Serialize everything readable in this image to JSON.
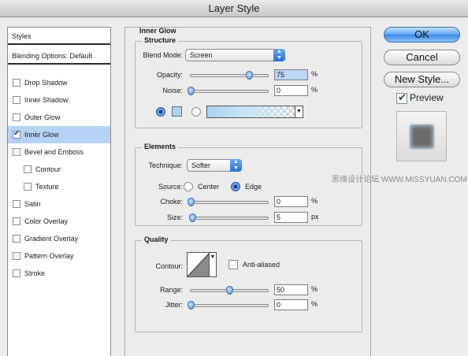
{
  "window": {
    "title": "Layer Style"
  },
  "left_panel": {
    "styles_label": "Styles",
    "blending_label": "Blending Options: Default",
    "items": [
      {
        "label": "Drop Shadow",
        "checked": false,
        "selected": false,
        "sub": false
      },
      {
        "label": "Inner Shadow",
        "checked": false,
        "selected": false,
        "sub": false
      },
      {
        "label": "Outer Glow",
        "checked": false,
        "selected": false,
        "sub": false
      },
      {
        "label": "Inner Glow",
        "checked": true,
        "selected": true,
        "sub": false
      },
      {
        "label": "Bevel and Emboss",
        "checked": false,
        "selected": false,
        "sub": false
      },
      {
        "label": "Contour",
        "checked": false,
        "selected": false,
        "sub": true
      },
      {
        "label": "Texture",
        "checked": false,
        "selected": false,
        "sub": true
      },
      {
        "label": "Satin",
        "checked": false,
        "selected": false,
        "sub": false
      },
      {
        "label": "Color Overlay",
        "checked": false,
        "selected": false,
        "sub": false
      },
      {
        "label": "Gradient Overlay",
        "checked": false,
        "selected": false,
        "sub": false
      },
      {
        "label": "Pattern Overlay",
        "checked": false,
        "selected": false,
        "sub": false
      },
      {
        "label": "Stroke",
        "checked": false,
        "selected": false,
        "sub": false
      }
    ]
  },
  "inner_glow": {
    "title": "Inner Glow",
    "structure": {
      "title": "Structure",
      "blend_mode_label": "Blend Mode:",
      "blend_mode_value": "Screen",
      "opacity_label": "Opacity:",
      "opacity_value": "75",
      "opacity_level": 75,
      "noise_label": "Noise:",
      "noise_value": "0",
      "noise_level": 0,
      "percent": "%",
      "glow_color": "#a9d3f0",
      "color_radio_selected": true,
      "gradient_radio_selected": false
    },
    "elements": {
      "title": "Elements",
      "technique_label": "Technique:",
      "technique_value": "Softer",
      "source_label": "Source:",
      "source_center": "Center",
      "source_edge": "Edge",
      "source_selected": "Edge",
      "choke_label": "Choke:",
      "choke_value": "0",
      "choke_level": 0,
      "size_label": "Size:",
      "size_value": "5",
      "size_level": 2,
      "percent": "%",
      "px": "px"
    },
    "quality": {
      "title": "Quality",
      "contour_label": "Contour:",
      "anti_aliased_label": "Anti-aliased",
      "anti_aliased_checked": false,
      "range_label": "Range:",
      "range_value": "50",
      "range_level": 50,
      "jitter_label": "Jitter:",
      "jitter_value": "0",
      "jitter_level": 0,
      "percent": "%"
    }
  },
  "buttons": {
    "ok": "OK",
    "cancel": "Cancel",
    "new_style": "New Style...",
    "preview_label": "Preview",
    "preview_checked": true
  },
  "watermark": "思缘设计论坛 WWW.MISSYUAN.COM",
  "colors": {
    "accent": "#3b86e4",
    "selection": "#b6d3f7"
  }
}
